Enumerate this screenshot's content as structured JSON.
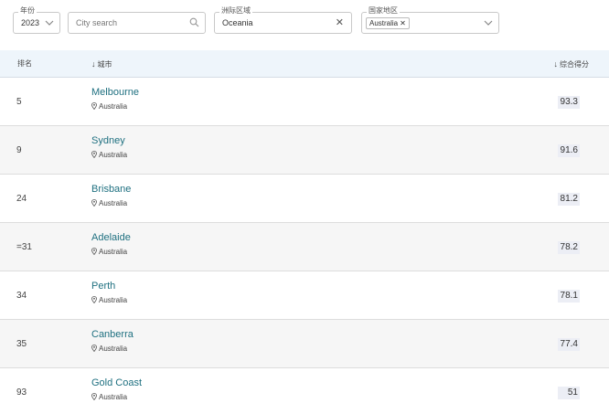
{
  "filters": {
    "year": {
      "label": "年份",
      "value": "2023"
    },
    "search": {
      "placeholder": "City search"
    },
    "region": {
      "label": "洲际区域",
      "value": "Oceania"
    },
    "country": {
      "label": "国家地区",
      "chip": "Australia",
      "chip_remove": "✕"
    }
  },
  "table": {
    "headers": {
      "rank": "排名",
      "city": "城市",
      "score": "综合得分",
      "sort_arrow": "↓"
    },
    "rows": [
      {
        "rank": "5",
        "city": "Melbourne",
        "country": "Australia",
        "score": "93.3"
      },
      {
        "rank": "9",
        "city": "Sydney",
        "country": "Australia",
        "score": "91.6"
      },
      {
        "rank": "24",
        "city": "Brisbane",
        "country": "Australia",
        "score": "81.2"
      },
      {
        "rank": "=31",
        "city": "Adelaide",
        "country": "Australia",
        "score": "78.2"
      },
      {
        "rank": "34",
        "city": "Perth",
        "country": "Australia",
        "score": "78.1"
      },
      {
        "rank": "35",
        "city": "Canberra",
        "country": "Australia",
        "score": "77.4"
      },
      {
        "rank": "93",
        "city": "Gold Coast",
        "country": "Australia",
        "score": "51"
      }
    ]
  }
}
